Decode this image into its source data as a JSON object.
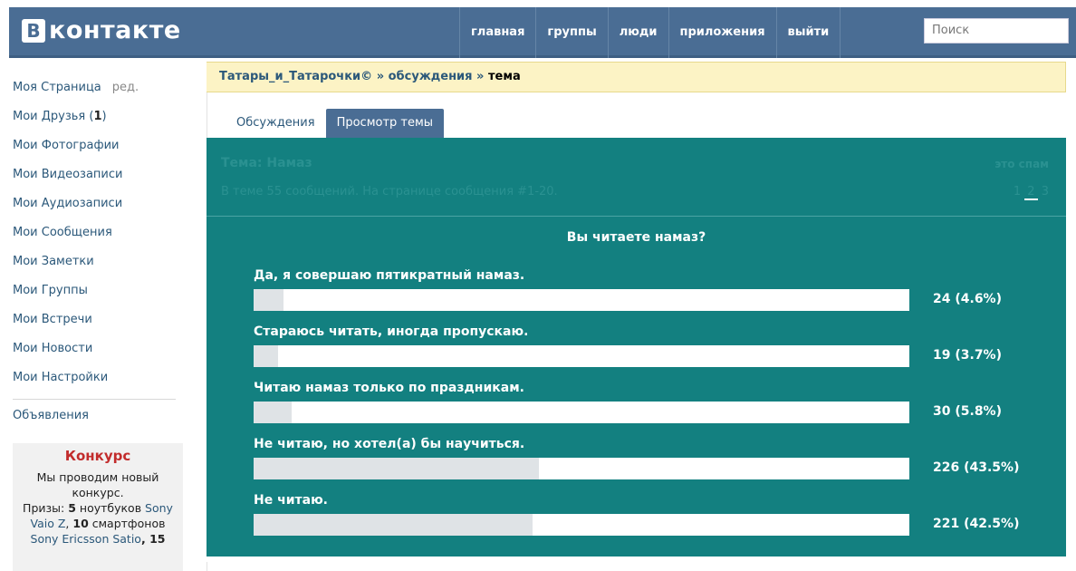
{
  "header": {
    "logo_letter": "В",
    "logo_text": "контакте",
    "nav": [
      "главная",
      "группы",
      "люди",
      "приложения",
      "выйти"
    ],
    "search_placeholder": "Поиск"
  },
  "sidebar": {
    "my_page": "Моя Страница",
    "edit": "ред.",
    "friends_label": "Мои Друзья (",
    "friends_count": "1",
    "friends_close": ")",
    "items": [
      "Мои Фотографии",
      "Мои Видеозаписи",
      "Мои Аудиозаписи",
      "Мои Сообщения",
      "Мои Заметки",
      "Мои Группы",
      "Мои Встречи",
      "Мои Новости",
      "Мои Настройки"
    ],
    "ads": "Объявления",
    "contest": {
      "title": "Конкурс",
      "line1": "Мы проводим новый конкурс.",
      "prizes_label": "Призы: ",
      "prizes_num1": "5",
      "prizes_item1": " ноутбуков ",
      "prizes_link1": "Sony Vaio Z",
      "prizes_sep": ", ",
      "prizes_num2": "10",
      "prizes_item2": " смартфонов ",
      "prizes_link2": "Sony Ericsson Satio",
      "prizes_num3": ", 15"
    }
  },
  "main": {
    "breadcrumb_group": "Татары_и_Татарочки©",
    "breadcrumb_sep1": " » ",
    "breadcrumb_discussions": "обсуждения",
    "breadcrumb_sep2": " » ",
    "breadcrumb_current": "тема",
    "tabs": [
      "Обсуждения",
      "Просмотр темы"
    ],
    "topic_label": "Тема: ",
    "topic_name": "Намаз",
    "spam": "это спам",
    "info": "В теме 55 сообщений. На странице сообщения #1-20.",
    "pages": [
      "1",
      "2",
      "3"
    ],
    "poll": {
      "question": "Вы читаете намаз?",
      "options": [
        {
          "label": "Да, я совершаю пятикратный намаз.",
          "value": "24 (4.6%)",
          "percent": 4.6
        },
        {
          "label": "Стараюсь читать, иногда пропускаю.",
          "value": "19 (3.7%)",
          "percent": 3.7
        },
        {
          "label": "Читаю намаз только по праздникам.",
          "value": "30 (5.8%)",
          "percent": 5.8
        },
        {
          "label": "Не читаю, но хотел(а) бы научиться.",
          "value": "226 (43.5%)",
          "percent": 43.5
        },
        {
          "label": "Не читаю.",
          "value": "221 (42.5%)",
          "percent": 42.5
        }
      ]
    }
  },
  "colors": {
    "header_bg": "#4a6d94",
    "panel_bg": "#138080",
    "breadcrumb_bg": "#fcf3c5",
    "link": "#2b587a",
    "contest_title": "#c22c2c"
  }
}
